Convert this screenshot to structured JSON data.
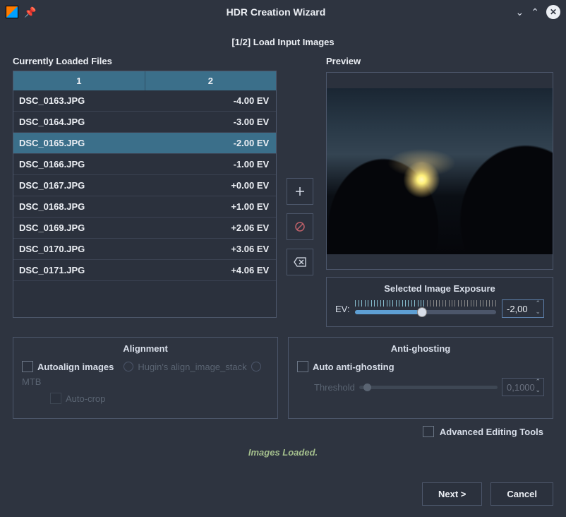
{
  "titlebar": {
    "title": "HDR Creation Wizard"
  },
  "step_title": "[1/2] Load Input Images",
  "left": {
    "header": "Currently Loaded Files",
    "columns": [
      "1",
      "2"
    ],
    "rows": [
      {
        "file": "DSC_0163.JPG",
        "ev": "-4.00 EV"
      },
      {
        "file": "DSC_0164.JPG",
        "ev": "-3.00 EV"
      },
      {
        "file": "DSC_0165.JPG",
        "ev": "-2.00 EV",
        "selected": true
      },
      {
        "file": "DSC_0166.JPG",
        "ev": "-1.00 EV"
      },
      {
        "file": "DSC_0167.JPG",
        "ev": "+0.00 EV"
      },
      {
        "file": "DSC_0168.JPG",
        "ev": "+1.00 EV"
      },
      {
        "file": "DSC_0169.JPG",
        "ev": "+2.06 EV"
      },
      {
        "file": "DSC_0170.JPG",
        "ev": "+3.06 EV"
      },
      {
        "file": "DSC_0171.JPG",
        "ev": "+4.06 EV"
      }
    ]
  },
  "preview": {
    "header": "Preview"
  },
  "exposure": {
    "title": "Selected Image Exposure",
    "label": "EV:",
    "value": "-2,00"
  },
  "alignment": {
    "title": "Alignment",
    "autoalign": "Autoalign images",
    "hugin": "Hugin's align_image_stack",
    "mtb": "MTB",
    "autocrop": "Auto-crop"
  },
  "antighost": {
    "title": "Anti-ghosting",
    "auto": "Auto anti-ghosting",
    "threshold_label": "Threshold",
    "threshold_value": "0,1000"
  },
  "advanced_label": "Advanced Editing Tools",
  "status": "Images Loaded.",
  "footer": {
    "next": "Next >",
    "cancel": "Cancel"
  }
}
